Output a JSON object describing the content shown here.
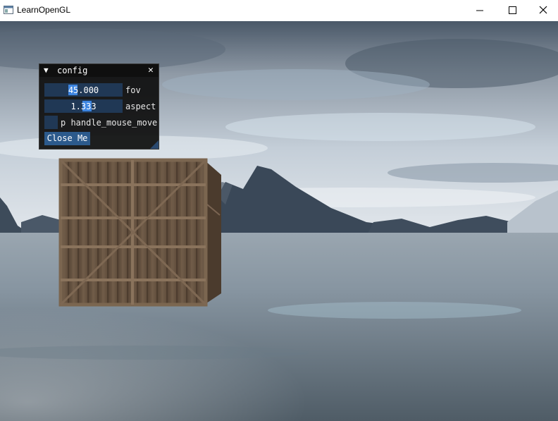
{
  "window": {
    "title": "LearnOpenGL",
    "icon": "app-window-icon",
    "controls": {
      "minimize_icon": "minimize-icon",
      "maximize_icon": "maximize-icon",
      "close_icon": "close-icon"
    }
  },
  "imgui": {
    "title": "config",
    "collapse_glyph": "▼",
    "close_glyph": "✕",
    "fov": {
      "value_text": "45.000",
      "label": "fov"
    },
    "aspect": {
      "value_text": "1.333",
      "label": "aspect"
    },
    "mouse_toggle": {
      "label": "p handle_mouse_move",
      "checked": false
    },
    "close_button": "Close Me",
    "colors": {
      "window_bg": "#0d0d0d",
      "frame_bg": "#203855",
      "slider_grab": "#3d85e0",
      "button": "#2c5a8c"
    }
  },
  "scene": {
    "objects": [
      "skybox-sky",
      "mountain-range",
      "lake-water",
      "wooden-crate"
    ],
    "colors": {
      "sky_top": "#4a5868",
      "sky_horizon": "#d8e0e8",
      "water": "#7d8c98",
      "mountain": "#3a4a5a",
      "crate": "#6e5a47"
    }
  }
}
